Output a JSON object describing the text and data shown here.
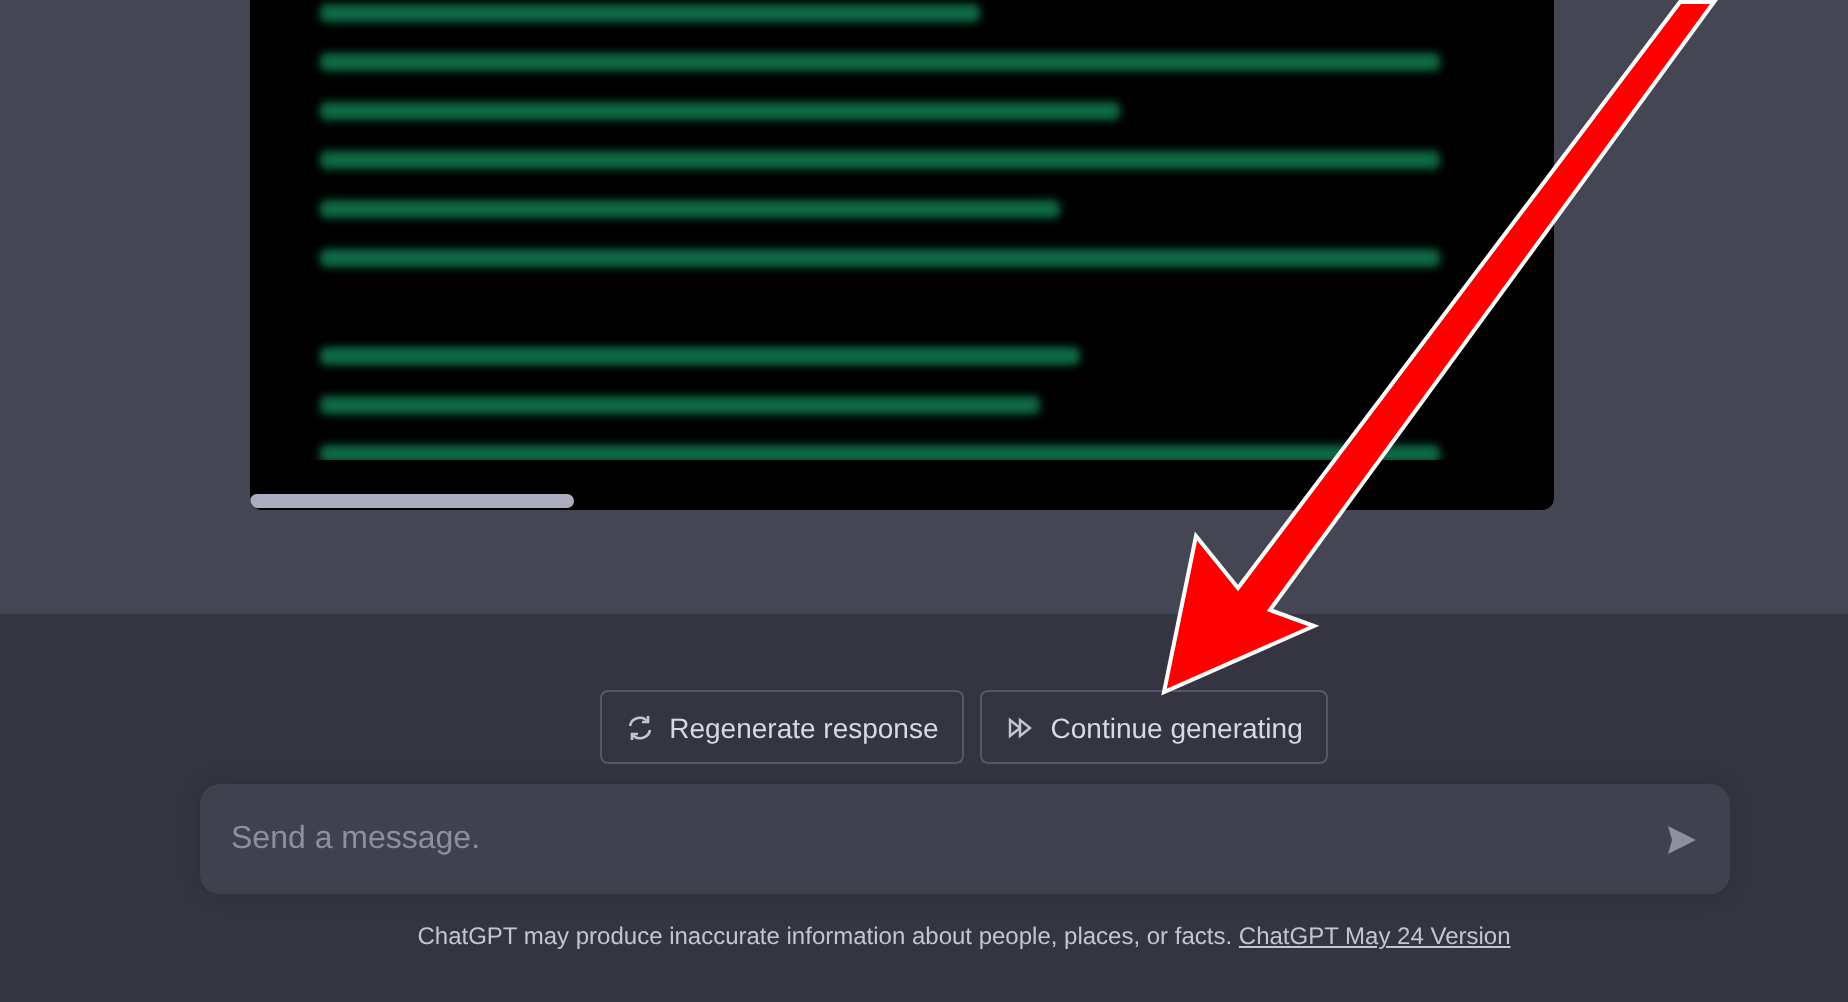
{
  "actions": [
    {
      "kind": "regenerate",
      "label": "Regenerate response"
    },
    {
      "kind": "continue",
      "label": "Continue generating"
    }
  ],
  "composer": {
    "placeholder": "Send a message."
  },
  "footer": {
    "text": "ChatGPT may produce inaccurate information about people, places, or facts.",
    "link": "ChatGPT May 24 Version"
  }
}
